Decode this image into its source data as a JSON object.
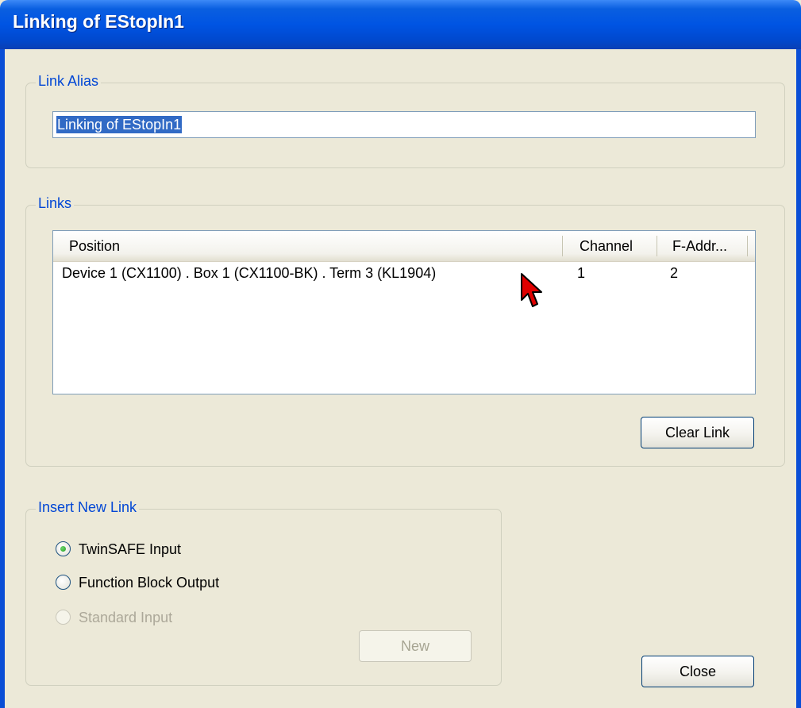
{
  "window": {
    "title": "Linking of EStopIn1"
  },
  "link_alias": {
    "legend": "Link Alias",
    "value": "Linking of EStopIn1"
  },
  "links": {
    "legend": "Links",
    "columns": [
      "Position",
      "Channel",
      "F-Addr..."
    ],
    "rows": [
      {
        "position": "Device 1 (CX1100) . Box 1 (CX1100-BK) . Term 3 (KL1904)",
        "channel": "1",
        "f_addr": "2"
      }
    ],
    "clear_label": "Clear Link"
  },
  "insert_new_link": {
    "legend": "Insert New Link",
    "options": [
      {
        "label": "TwinSAFE Input",
        "selected": true,
        "enabled": true
      },
      {
        "label": "Function Block Output",
        "selected": false,
        "enabled": true
      },
      {
        "label": "Standard Input",
        "selected": false,
        "enabled": false
      }
    ],
    "new_label": "New"
  },
  "close_label": "Close",
  "colors": {
    "title_bar": "#0054e3",
    "dialog_bg": "#ece9d8",
    "group_legend": "#0046d5",
    "selection": "#316ac5",
    "cursor": "#e00000"
  }
}
